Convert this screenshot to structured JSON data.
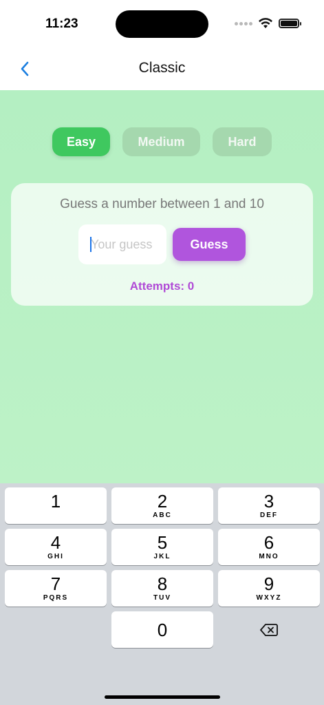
{
  "status_bar": {
    "time": "11:23"
  },
  "nav": {
    "title": "Classic"
  },
  "difficulty": {
    "easy": "Easy",
    "medium": "Medium",
    "hard": "Hard"
  },
  "game": {
    "prompt": "Guess a number between 1 and 10",
    "input_placeholder": "Your guess",
    "input_value": "",
    "guess_label": "Guess",
    "attempts_label": "Attempts: ",
    "attempts_count": "0"
  },
  "keyboard": {
    "keys": [
      {
        "digit": "1",
        "letters": ""
      },
      {
        "digit": "2",
        "letters": "ABC"
      },
      {
        "digit": "3",
        "letters": "DEF"
      },
      {
        "digit": "4",
        "letters": "GHI"
      },
      {
        "digit": "5",
        "letters": "JKL"
      },
      {
        "digit": "6",
        "letters": "MNO"
      },
      {
        "digit": "7",
        "letters": "PQRS"
      },
      {
        "digit": "8",
        "letters": "TUV"
      },
      {
        "digit": "9",
        "letters": "WXYZ"
      },
      {
        "digit": "0",
        "letters": ""
      }
    ],
    "delete_icon": "delete-backward-icon"
  },
  "colors": {
    "background": "#b4efc2",
    "easy_active": "#3fc85f",
    "inactive": "#a5d8ae",
    "accent_purple": "#b055dd",
    "nav_blue": "#1a7ee0"
  }
}
